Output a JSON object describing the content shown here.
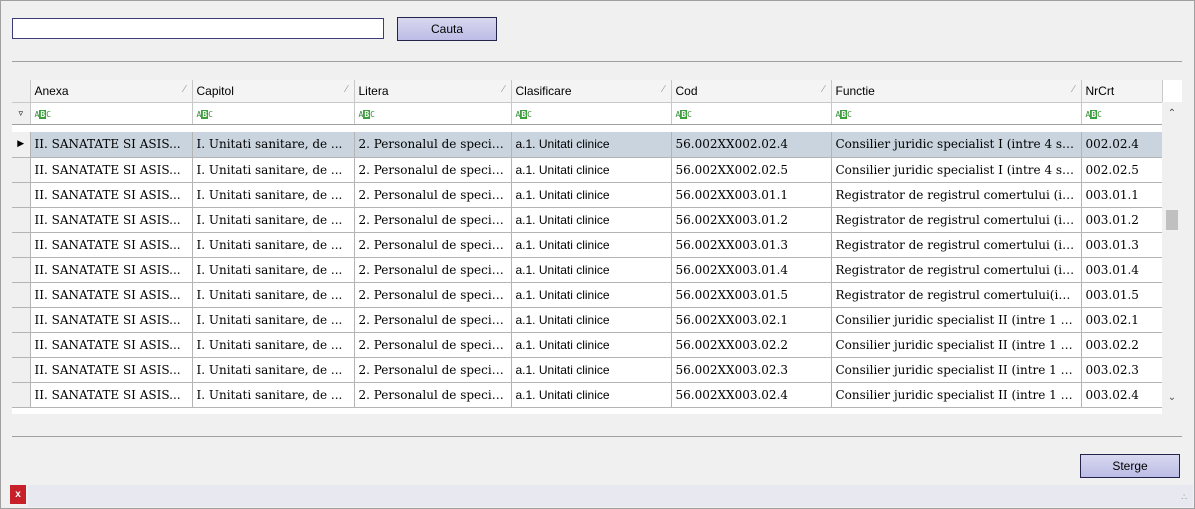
{
  "search": {
    "value": "",
    "button_label": "Cauta"
  },
  "grid": {
    "columns": [
      "Anexa",
      "Capitol",
      "Litera",
      "Clasificare",
      "Cod",
      "Functie",
      "NrCrt"
    ],
    "filter_icon": "filter-icon",
    "filter_text_icon": "abc-text-filter-icon",
    "selected_row_index": 0,
    "rows": [
      [
        "II. SANATATE SI ASIS...",
        "I. Unitati sanitare, de ...",
        "2. Personalul de specia...",
        "a.1. Unitati clinice",
        "56.002XX002.02.4",
        "Consilier juridic specialist I (intre 4 si ...",
        "002.02.4"
      ],
      [
        "II. SANATATE SI ASIS...",
        "I. Unitati sanitare, de ...",
        "2. Personalul de specia...",
        "a.1. Unitati clinice",
        "56.002XX002.02.5",
        "Consilier juridic specialist I (intre 4 si 7...",
        "002.02.5"
      ],
      [
        "II. SANATATE SI ASIS...",
        "I. Unitati sanitare, de ...",
        "2. Personalul de specia...",
        "a.1. Unitati clinice",
        "56.002XX003.01.1",
        "Registrator de registrul comertului  (in...",
        "003.01.1"
      ],
      [
        "II. SANATATE SI ASIS...",
        "I. Unitati sanitare, de ...",
        "2. Personalul de specia...",
        "a.1. Unitati clinice",
        "56.002XX003.01.2",
        "Registrator de registrul comertului (in...",
        "003.01.2"
      ],
      [
        "II. SANATATE SI ASIS...",
        "I. Unitati sanitare, de ...",
        "2. Personalul de specia...",
        "a.1. Unitati clinice",
        "56.002XX003.01.3",
        "Registrator de registrul comertului (in...",
        "003.01.3"
      ],
      [
        "II. SANATATE SI ASIS...",
        "I. Unitati sanitare, de ...",
        "2. Personalul de specia...",
        "a.1. Unitati clinice",
        "56.002XX003.01.4",
        "Registrator de registrul comertului (in...",
        "003.01.4"
      ],
      [
        "II. SANATATE SI ASIS...",
        "I. Unitati sanitare, de ...",
        "2. Personalul de specia...",
        "a.1. Unitati clinice",
        "56.002XX003.01.5",
        "Registrator de registrul comertului(int...",
        "003.01.5"
      ],
      [
        "II. SANATATE SI ASIS...",
        "I. Unitati sanitare, de ...",
        "2. Personalul de specia...",
        "a.1. Unitati clinice",
        "56.002XX003.02.1",
        "Consilier juridic specialist II (intre 1 si ...",
        "003.02.1"
      ],
      [
        "II. SANATATE SI ASIS...",
        "I. Unitati sanitare, de ...",
        "2. Personalul de specia...",
        "a.1. Unitati clinice",
        "56.002XX003.02.2",
        "Consilier juridic specialist II (intre 1 si ...",
        "003.02.2"
      ],
      [
        "II. SANATATE SI ASIS...",
        "I. Unitati sanitare, de ...",
        "2. Personalul de specia...",
        "a.1. Unitati clinice",
        "56.002XX003.02.3",
        "Consilier juridic specialist II (intre 1 si ...",
        "003.02.3"
      ],
      [
        "II. SANATATE SI ASIS...",
        "I. Unitati sanitare, de ...",
        "2. Personalul de specia...",
        "a.1. Unitati clinice",
        "56.002XX003.02.4",
        "Consilier juridic specialist II (intre 1 si ...",
        "003.02.4"
      ]
    ]
  },
  "footer": {
    "delete_label": "Sterge",
    "close_label": "x"
  },
  "colors": {
    "selected_row": "#c9d4de",
    "button_border": "#24244a",
    "close_red": "#c8202a"
  }
}
